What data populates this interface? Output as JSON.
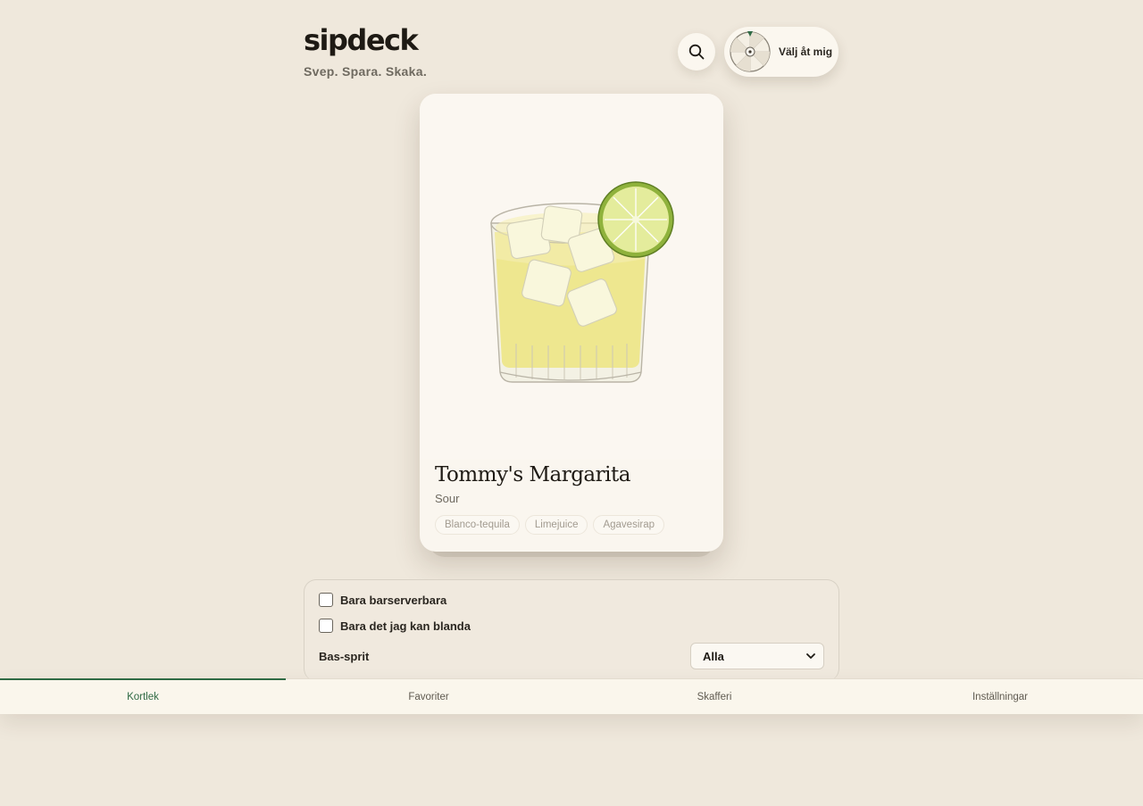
{
  "header": {
    "logo": "sipdeck",
    "tagline": "Svep. Spara. Skaka.",
    "search_icon": "search-icon",
    "wheel_button_label": "Välj åt mig",
    "wheel_icon": "spin-wheel-icon"
  },
  "card": {
    "image_subject": "margarita-glass-illustration",
    "title": "Tommy's Margarita",
    "category": "Sour",
    "ingredients": [
      "Blanco-tequila",
      "Limejuice",
      "Agavesirap"
    ]
  },
  "filters": {
    "only_bar_servable": {
      "label": "Bara barserverbara",
      "checked": false
    },
    "only_can_mix": {
      "label": "Bara det jag kan blanda",
      "checked": false
    },
    "base_spirit": {
      "label": "Bas-sprit",
      "selected": "Alla"
    }
  },
  "tabs": [
    {
      "label": "Kortlek",
      "active": true
    },
    {
      "label": "Favoriter",
      "active": false
    },
    {
      "label": "Skafferi",
      "active": false
    },
    {
      "label": "Inställningar",
      "active": false
    }
  ],
  "colors": {
    "background": "#efe8dc",
    "accent": "#2f6a44",
    "card": "#faf6ef"
  }
}
